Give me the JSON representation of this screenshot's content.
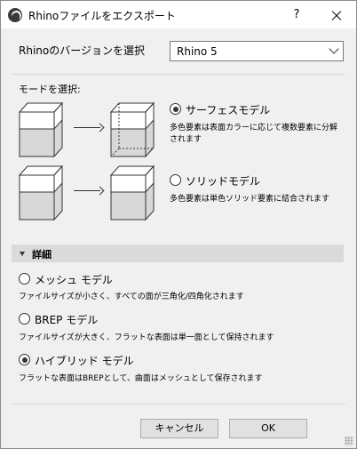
{
  "window": {
    "title": "Rhinoファイルをエクスポート",
    "help_label": "?"
  },
  "version": {
    "label": "Rhinoのバージョンを選択",
    "selected": "Rhino 5"
  },
  "mode": {
    "label": "モードを選択:",
    "options": [
      {
        "title": "サーフェスモデル",
        "desc_line1": "多色要素は表面カラーに応じて複数要素に分解",
        "desc_line2": "されます",
        "checked": true
      },
      {
        "title": "ソリッドモデル",
        "desc_line1": "多色要素は単色ソリッド要素に結合されます",
        "checked": false
      }
    ]
  },
  "details": {
    "label": "詳細",
    "options": [
      {
        "title": "メッシュ モデル",
        "desc": "ファイルサイズが小さく、すべての面が三角化/四角化されます",
        "checked": false
      },
      {
        "title": "BREP モデル",
        "desc": "ファイルサイズが大きく、フラットな表面は単一面として保持されます",
        "checked": false
      },
      {
        "title": "ハイブリッド モデル",
        "desc": "フラットな表面はBREPとして、曲面はメッシュとして保存されます",
        "checked": true
      }
    ]
  },
  "buttons": {
    "cancel": "キャンセル",
    "ok": "OK"
  }
}
